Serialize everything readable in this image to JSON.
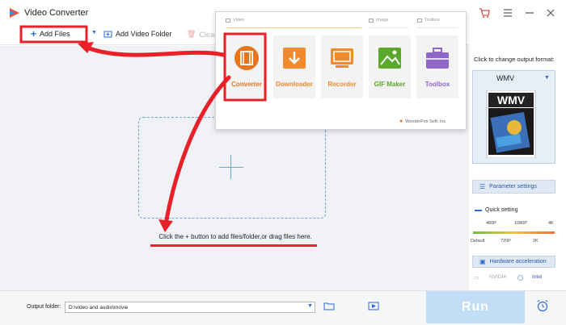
{
  "window": {
    "title": "Video Converter",
    "controls": [
      "cart-icon",
      "hamburger-menu-icon",
      "minimize-icon",
      "close-icon"
    ]
  },
  "toolbar": {
    "add_files_label": "Add Files",
    "add_folder_label": "Add Video Folder",
    "clear_label": "Clear"
  },
  "main": {
    "drop_hint": "Click the + button to add files/folder,or drag files here."
  },
  "popup": {
    "sections": {
      "video": "Video",
      "image": "Image",
      "toolbox": "Toolbox"
    },
    "tools": [
      {
        "label": "Converter",
        "color": "#e8741c",
        "icon": "film-reel-icon"
      },
      {
        "label": "Downloader",
        "color": "#f08a2a",
        "icon": "download-icon"
      },
      {
        "label": "Recorder",
        "color": "#f08a2a",
        "icon": "screen-record-icon"
      },
      {
        "label": "GIF Maker",
        "color": "#5aa82c",
        "icon": "image-icon"
      },
      {
        "label": "Toolbox",
        "color": "#8e66c8",
        "icon": "toolbox-icon"
      }
    ],
    "footer": "WonderFox Soft, Inc."
  },
  "right_panel": {
    "caption": "Click to change output format:",
    "format": "WMV",
    "param_settings_label": "Parameter settings",
    "quick_setting_label": "Quick setting",
    "ticks_top": [
      "480P",
      "1080P",
      "4K"
    ],
    "ticks_bottom": [
      "Default",
      "720P",
      "2K"
    ],
    "hw_accel_label": "Hardware acceleration",
    "gpu_nvidia": "NVIDIA",
    "gpu_intel": "Intel"
  },
  "bottom": {
    "output_label": "Output folder:",
    "output_path": "D:\\video and audio\\movie",
    "run_label": "Run"
  },
  "colors": {
    "accent": "#2a6bd8",
    "annotation": "#e8202a",
    "run_disabled": "#c2ddf6",
    "drop_border": "#6ea6e0"
  }
}
